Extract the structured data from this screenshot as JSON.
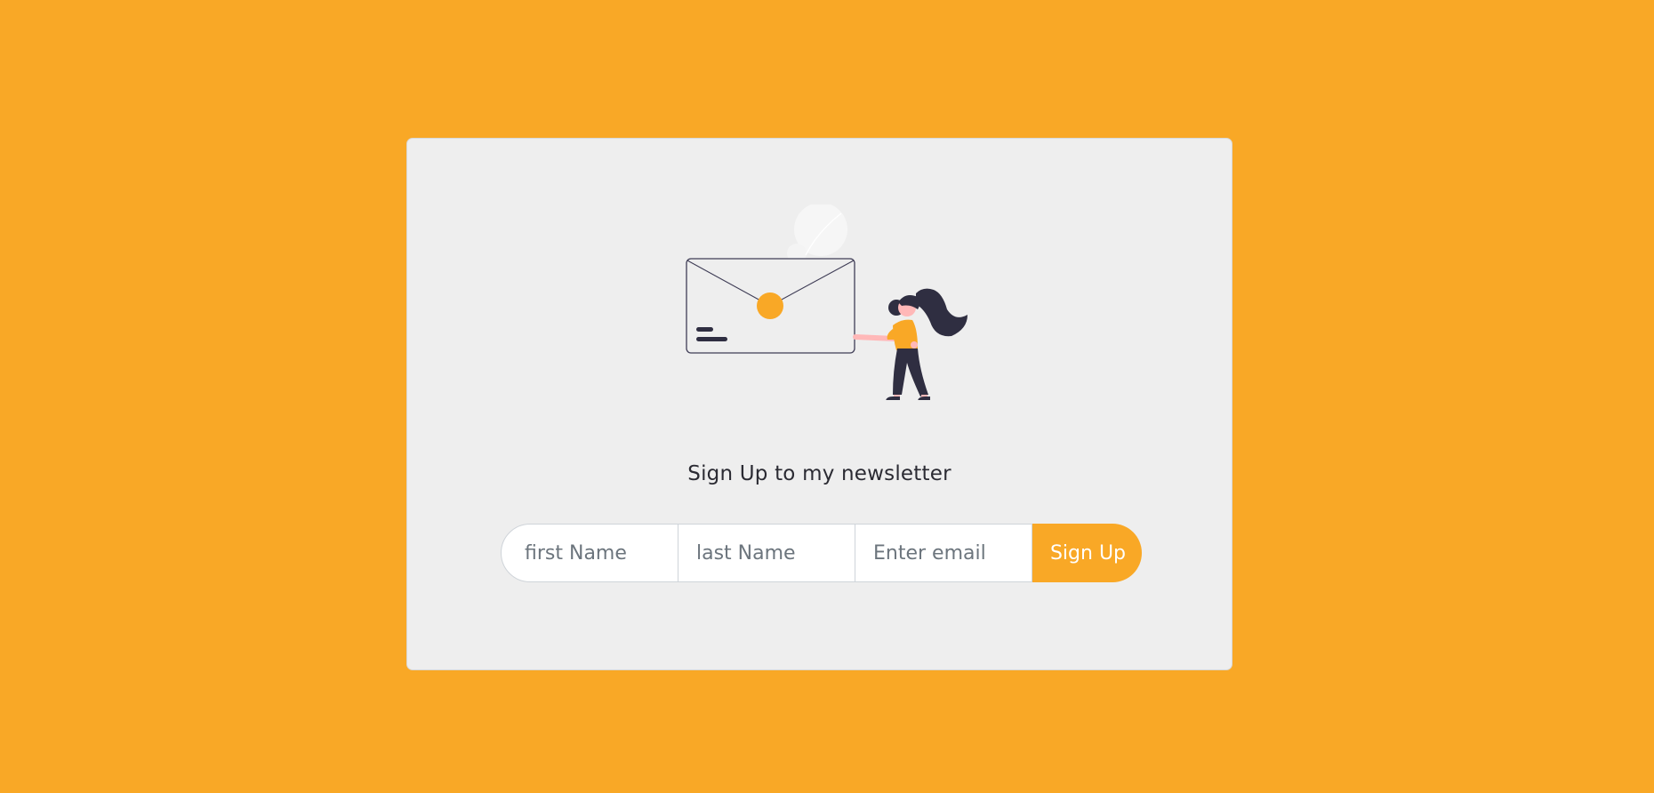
{
  "colors": {
    "background": "#F9A826",
    "card": "#EEEEEE",
    "accent": "#F9A826",
    "ink": "#2F2E41",
    "skin": "#FFB8B8"
  },
  "illustration": {
    "icon": "woman-holding-envelope-illustration"
  },
  "newsletter": {
    "headline": "Sign Up to my newsletter",
    "first_name_placeholder": "first Name",
    "last_name_placeholder": "last Name",
    "email_placeholder": "Enter email",
    "submit_label": "Sign Up"
  }
}
